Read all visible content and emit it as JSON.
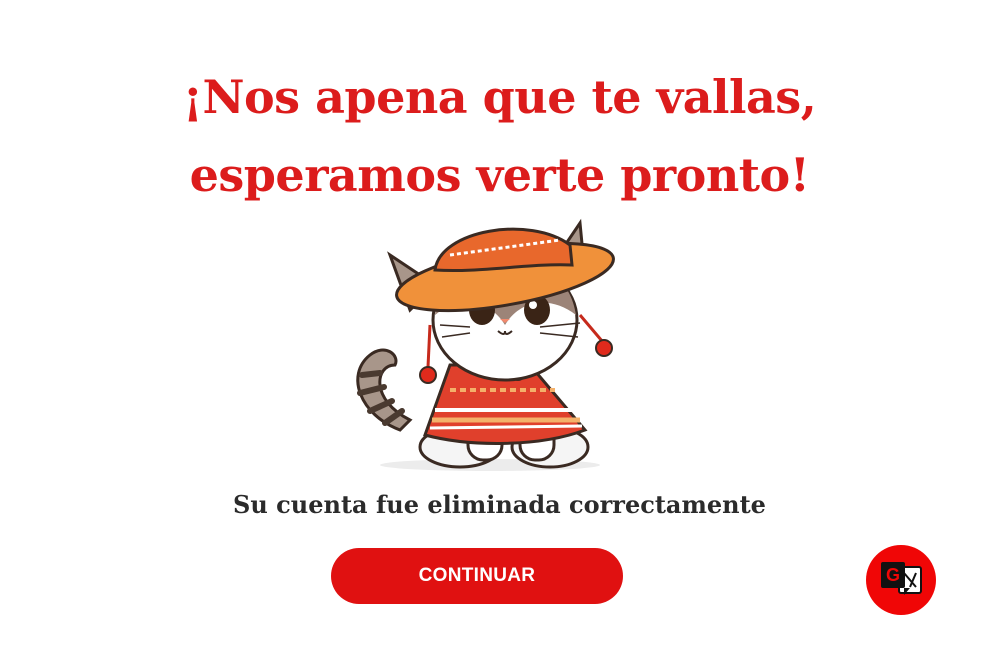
{
  "headline": {
    "line1": "¡Nos apena que te vallas,",
    "line2": "esperamos verte pronto!"
  },
  "illustration": {
    "subject": "cat-in-peruvian-hat-and-poncho"
  },
  "message": {
    "text": "Su cuenta fue eliminada correctamente"
  },
  "continue_button": {
    "label": "CONTINUAR"
  },
  "translate_widget": {
    "icon": "google-translate-icon"
  },
  "colors": {
    "accent": "#dc1c1c",
    "button": "#e01111",
    "text": "#2b2b2b",
    "background": "#ffffff"
  }
}
